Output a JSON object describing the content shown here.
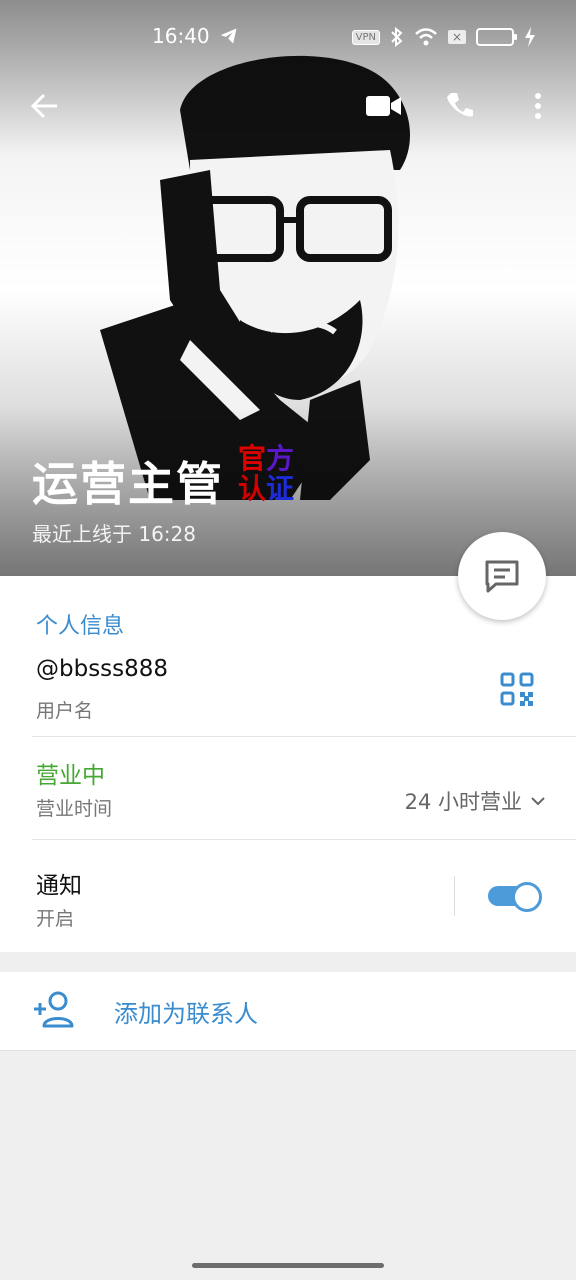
{
  "status_bar": {
    "time": "16:40",
    "vpn_label": "VPN",
    "icons": [
      "telegram-icon",
      "bluetooth-icon",
      "wifi-icon",
      "sim-icon",
      "battery-icon",
      "charging-icon"
    ]
  },
  "header": {
    "name": "运营主管",
    "badge_line1": [
      "官",
      "方"
    ],
    "badge_line2": [
      "认",
      "证"
    ],
    "last_seen": "最近上线于 16:28",
    "icons": [
      "back-arrow-icon",
      "video-call-icon",
      "phone-icon",
      "more-vert-icon",
      "chat-icon"
    ]
  },
  "info": {
    "section_title": "个人信息",
    "username": "@bbsss888",
    "username_label": "用户名",
    "business_status": "营业中",
    "business_label": "营业时间",
    "business_hours": "24 小时营业",
    "notify_title": "通知",
    "notify_status": "开启",
    "notify_enabled": true
  },
  "actions": {
    "add_contact": "添加为联系人"
  },
  "colors": {
    "accent": "#3a8ccf",
    "business_green": "#45a832",
    "toggle_on": "#4d9bd8"
  }
}
